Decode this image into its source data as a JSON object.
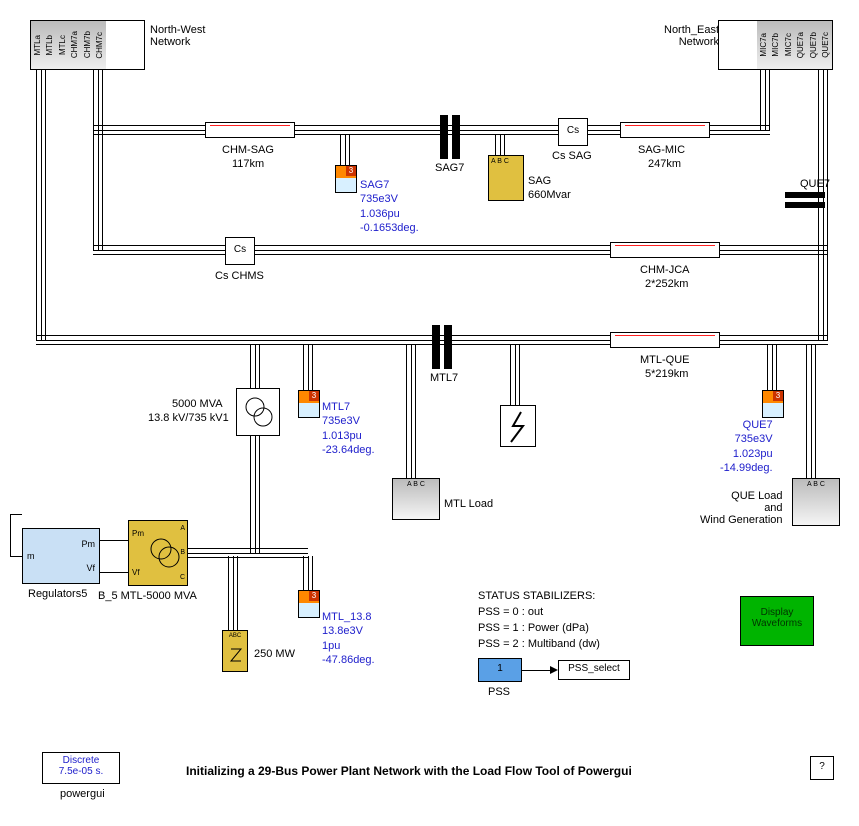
{
  "networks": {
    "nw": {
      "label": "North-West\nNetwork",
      "ports": [
        "MTLa",
        "MTLb",
        "MTLc",
        "CHM7a",
        "CHM7b",
        "CHM7c"
      ]
    },
    "ne": {
      "label": "North_East\nNetwork",
      "ports": [
        "MIC7a",
        "MIC7b",
        "MIC7c",
        "QUE7a",
        "QUE7b",
        "QUE7c"
      ]
    }
  },
  "lines": {
    "chm_sag": {
      "name": "CHM-SAG",
      "len": "117km"
    },
    "sag_mic": {
      "name": "SAG-MIC",
      "len": "247km"
    },
    "chm_jca": {
      "name": "CHM-JCA",
      "len": "2*252km"
    },
    "mtl_que": {
      "name": "MTL-QUE",
      "len": "5*219km"
    }
  },
  "buses": {
    "sag7": "SAG7",
    "mtl7": "MTL7",
    "que7": "QUE7"
  },
  "compensators": {
    "cs_sag": "Cs SAG",
    "cs_chms": "Cs CHMS",
    "cs_label": "Cs"
  },
  "sag_mvar": {
    "name": "SAG",
    "rating": "660Mvar"
  },
  "transformer": {
    "rating": "5000 MVA",
    "ratio": "13.8 kV/735 kV1"
  },
  "generator": "B_5 MTL-5000 MVA",
  "mw_src": "250 MW",
  "regulators": "Regulators5",
  "reg_ports": {
    "m": "m",
    "pm": "Pm",
    "vf": "Vf"
  },
  "loads": {
    "mtl": "MTL Load",
    "que": "QUE Load\nand\nWind Generation"
  },
  "measurements": {
    "sag7": {
      "name": "SAG7",
      "v": "735e3V",
      "pu": "1.036pu",
      "ang": "-0.1653deg."
    },
    "mtl7": {
      "name": "MTL7",
      "v": "735e3V",
      "pu": "1.013pu",
      "ang": "-23.64deg."
    },
    "que7": {
      "name": "QUE7",
      "v": "735e3V",
      "pu": "1.023pu",
      "ang": "-14.99deg."
    },
    "mtl13": {
      "name": "MTL_13.8",
      "v": "13.8e3V",
      "pu": "1pu",
      "ang": "-47.86deg."
    }
  },
  "status": {
    "title": "STATUS STABILIZERS:",
    "l0": "PSS = 0 :  out",
    "l1": "PSS = 1 :  Power (dPa)",
    "l2": "PSS = 2 :  Multiband (dw)"
  },
  "pss": {
    "value": "1",
    "label": "PSS",
    "select": "PSS_select"
  },
  "display_btn": "Display\nWaveforms",
  "powergui": {
    "l1": "Discrete",
    "l2": "7.5e-05 s.",
    "label": "powergui"
  },
  "title": "Initializing a 29-Bus Power Plant Network with the Load Flow Tool of Powergui",
  "help": "?"
}
